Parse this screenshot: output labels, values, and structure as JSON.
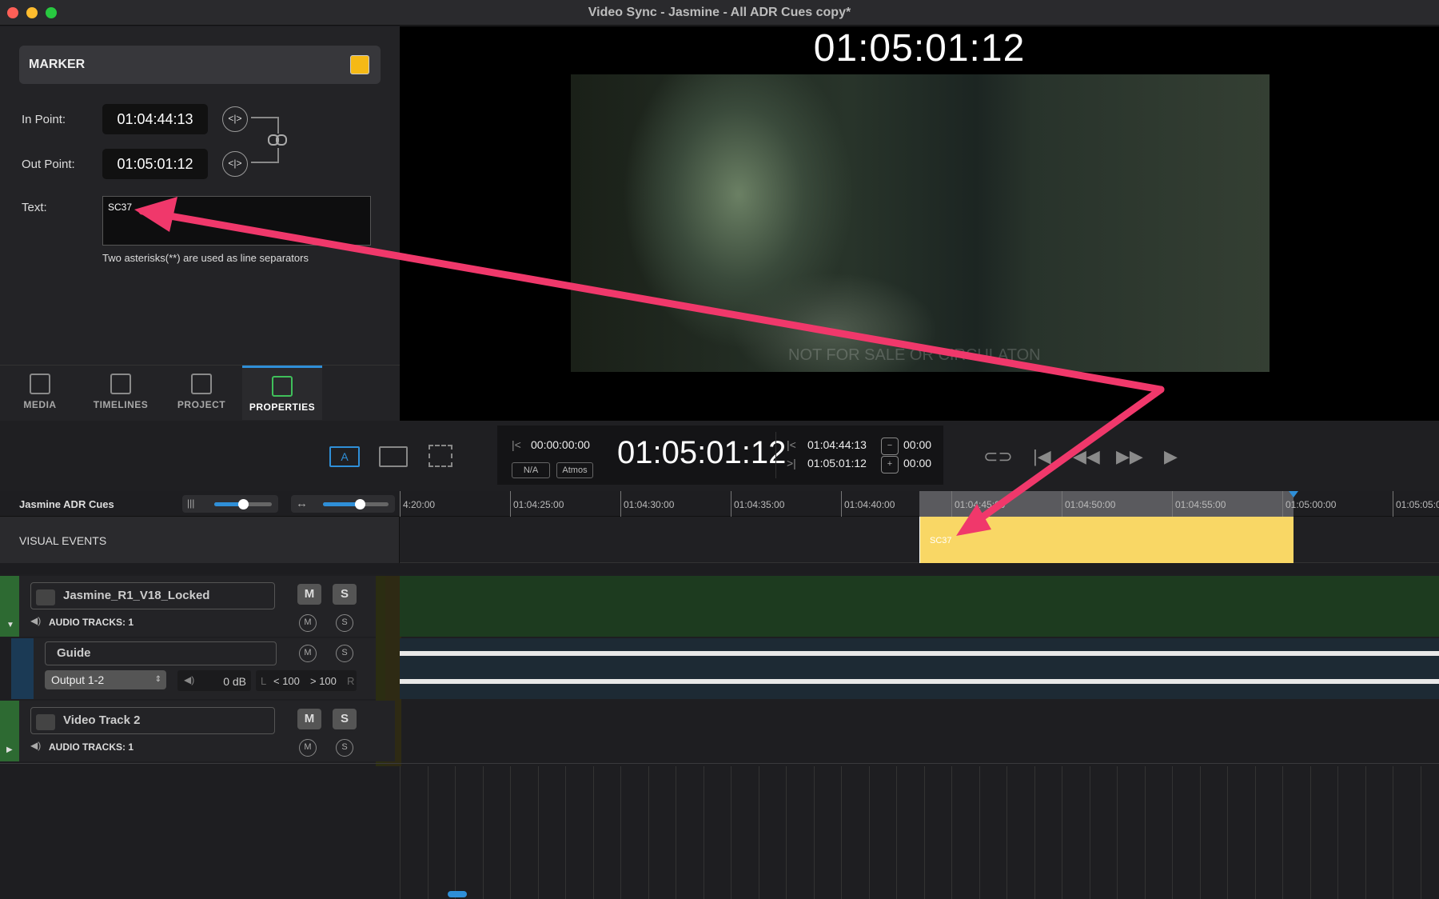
{
  "window": {
    "title": "Video Sync - Jasmine - All ADR Cues copy*"
  },
  "marker": {
    "title": "MARKER",
    "color": "#f5b915",
    "in_label": "In Point:",
    "in_value": "01:04:44:13",
    "out_label": "Out Point:",
    "out_value": "01:05:01:12",
    "text_label": "Text:",
    "text_value": "SC37",
    "note": "Two asterisks(**) are used as line separators"
  },
  "tabs": [
    {
      "label": "MEDIA"
    },
    {
      "label": "TIMELINES"
    },
    {
      "label": "PROJECT"
    },
    {
      "label": "PROPERTIES"
    }
  ],
  "viewer": {
    "timecode": "01:05:01:12",
    "watermark": "NOT FOR SALE OR CIRCULATON"
  },
  "transport": {
    "start_tc": "00:00:00:00",
    "na": "N/A",
    "atmos": "Atmos",
    "main_tc": "01:05:01:12",
    "in_tc": "01:04:44:13",
    "out_tc": "01:05:01:12",
    "minus_val": "00:00",
    "plus_val": "00:00",
    "mode_btn": "A"
  },
  "timeline": {
    "name": "Jasmine ADR Cues",
    "ticks": [
      "4:20:00",
      "01:04:25:00",
      "01:04:30:00",
      "01:04:35:00",
      "01:04:40:00",
      "01:04:45:00",
      "01:04:50:00",
      "01:04:55:00",
      "01:05:00:00",
      "01:05:05:00"
    ]
  },
  "visual_events": {
    "label": "VISUAL EVENTS",
    "marker_text": "SC37"
  },
  "tracks": {
    "track1": {
      "name": "Jasmine_R1_V18_Locked",
      "audio": "AUDIO TRACKS: 1"
    },
    "guide": {
      "name": "Guide",
      "output": "Output 1-2",
      "gain": "0 dB",
      "left": "L",
      "left_val": "< 100",
      "right_val": "> 100",
      "right": "R"
    },
    "track2": {
      "name": "Video Track 2",
      "audio": "AUDIO TRACKS: 1"
    },
    "m": "M",
    "s": "S"
  },
  "colors": {
    "accent": "#2f8fd8",
    "arrow": "#f0386b",
    "marker": "#f9d765"
  }
}
